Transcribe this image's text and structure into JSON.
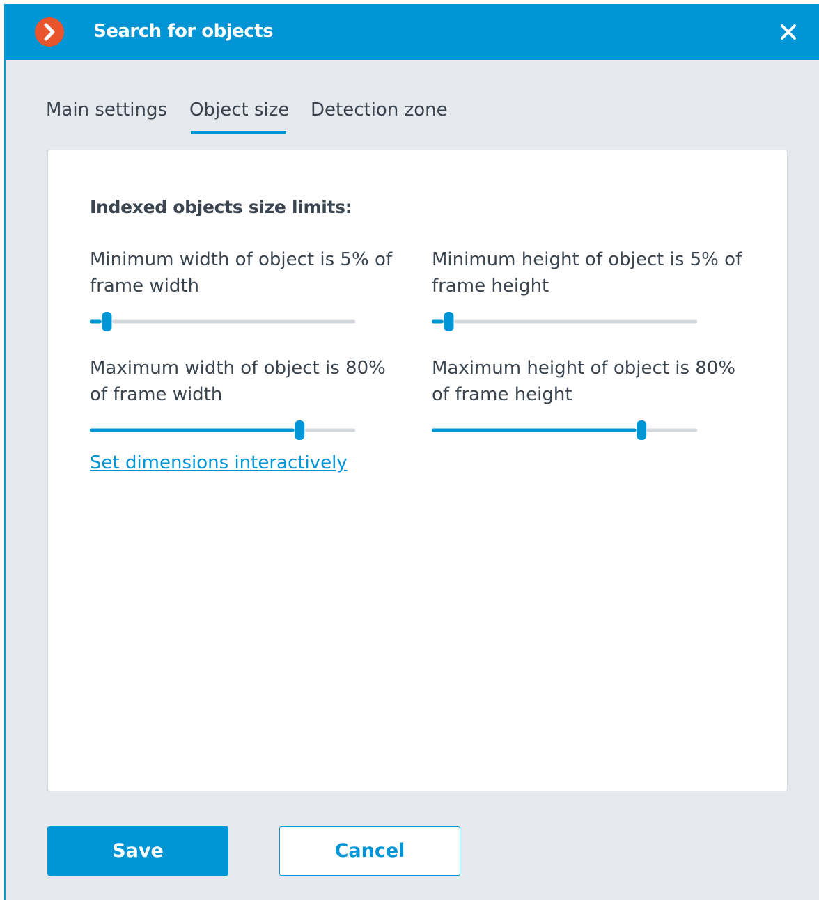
{
  "window": {
    "title": "Search for objects",
    "logo_icon": "chevron-right-icon",
    "close_icon": "close-icon"
  },
  "tabs": [
    {
      "label": "Main settings",
      "active": false
    },
    {
      "label": "Object size",
      "active": true
    },
    {
      "label": "Detection zone",
      "active": false
    }
  ],
  "panel": {
    "section_title": "Indexed objects size limits:",
    "sliders": {
      "min_width": {
        "label": "Minimum width of object is 5% of frame width",
        "value_percent": 5
      },
      "min_height": {
        "label": "Minimum height of object is 5% of frame height",
        "value_percent": 5
      },
      "max_width": {
        "label": "Maximum width of object is 80% of frame width",
        "value_percent": 80
      },
      "max_height": {
        "label": "Maximum height of object is 80% of frame height",
        "value_percent": 80
      }
    },
    "link_label": "Set dimensions interactively"
  },
  "buttons": {
    "save_label": "Save",
    "cancel_label": "Cancel"
  },
  "colors": {
    "accent": "#0096d6",
    "logo": "#e8542c",
    "track": "#d4d7dc",
    "background": "#e6e9ee"
  }
}
